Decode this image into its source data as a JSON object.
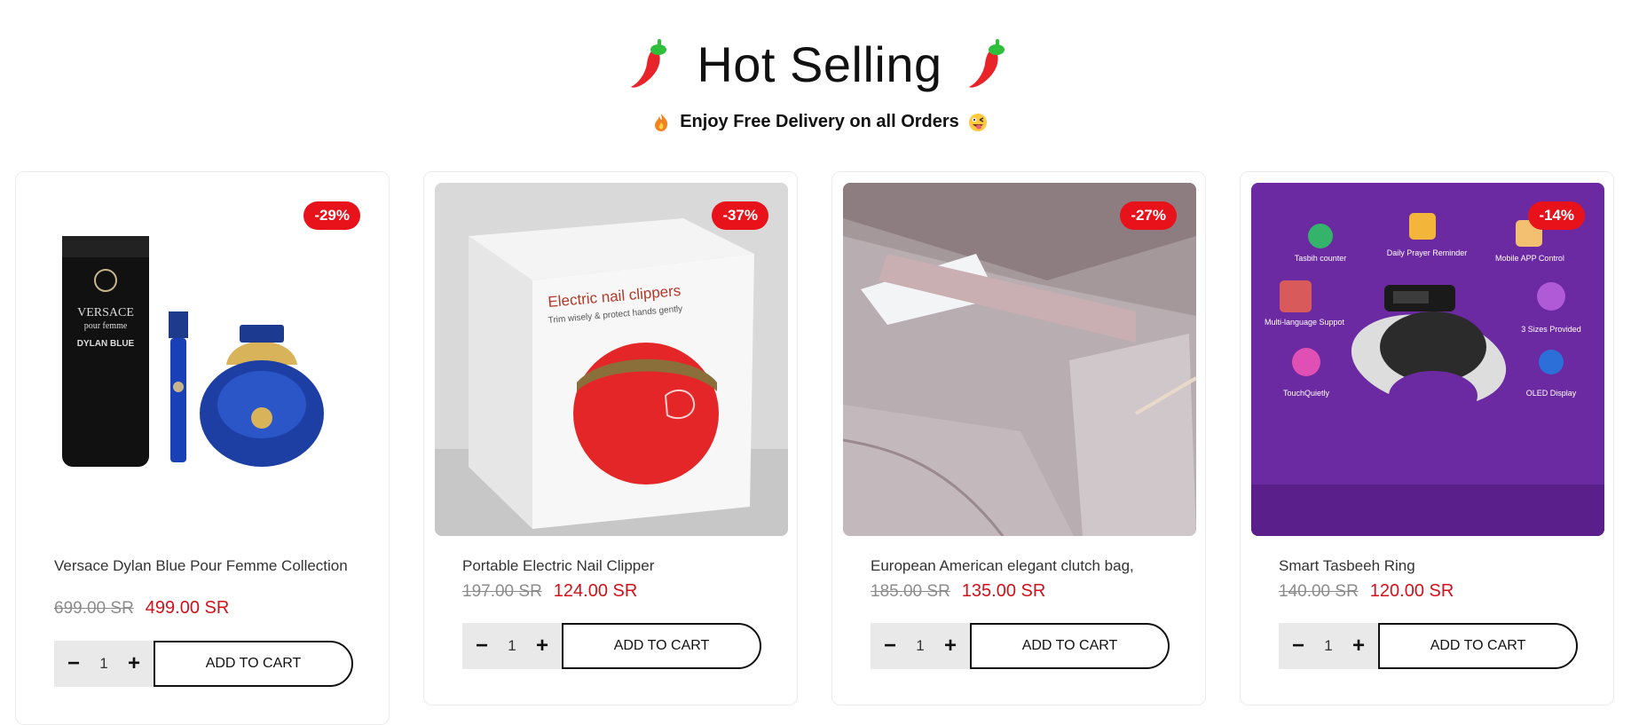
{
  "header": {
    "title": "Hot Selling",
    "subtitle": "Enjoy Free Delivery on all Orders"
  },
  "products": [
    {
      "name": "Versace Dylan Blue Pour Femme Collection",
      "discount": "-29%",
      "old_price": "699.00 SR",
      "new_price": "499.00 SR",
      "quantity": "1",
      "add_to_cart": "ADD TO CART",
      "image_texts": [
        "VERSACE",
        "pour femme",
        "DYLAN BLUE"
      ]
    },
    {
      "name": "Portable Electric Nail Clipper",
      "discount": "-37%",
      "old_price": "197.00 SR",
      "new_price": "124.00 SR",
      "quantity": "1",
      "add_to_cart": "ADD TO CART",
      "image_texts": [
        "Electric nail clippers",
        "Trim wisely & protect hands gently"
      ]
    },
    {
      "name": "European American elegant clutch bag,",
      "discount": "-27%",
      "old_price": "185.00 SR",
      "new_price": "135.00 SR",
      "quantity": "1",
      "add_to_cart": "ADD TO CART",
      "image_texts": []
    },
    {
      "name": "Smart Tasbeeh Ring",
      "discount": "-14%",
      "old_price": "140.00 SR",
      "new_price": "120.00 SR",
      "quantity": "1",
      "add_to_cart": "ADD TO CART",
      "image_texts": [
        "Tasbih counter",
        "Daily Prayer Reminder",
        "Mobile APP Control",
        "Multi-language Suppot",
        "3 Sizes Provided",
        "TouchQuietly",
        "OLED Display"
      ]
    }
  ],
  "icons": [
    "chili-pepper-icon",
    "flame-icon",
    "tongue-emoji-icon",
    "minus-icon",
    "plus-icon"
  ],
  "colors": {
    "accent": "#e8121b",
    "sale_price": "#d0121b",
    "ring_bg": "#6b2aa1"
  }
}
